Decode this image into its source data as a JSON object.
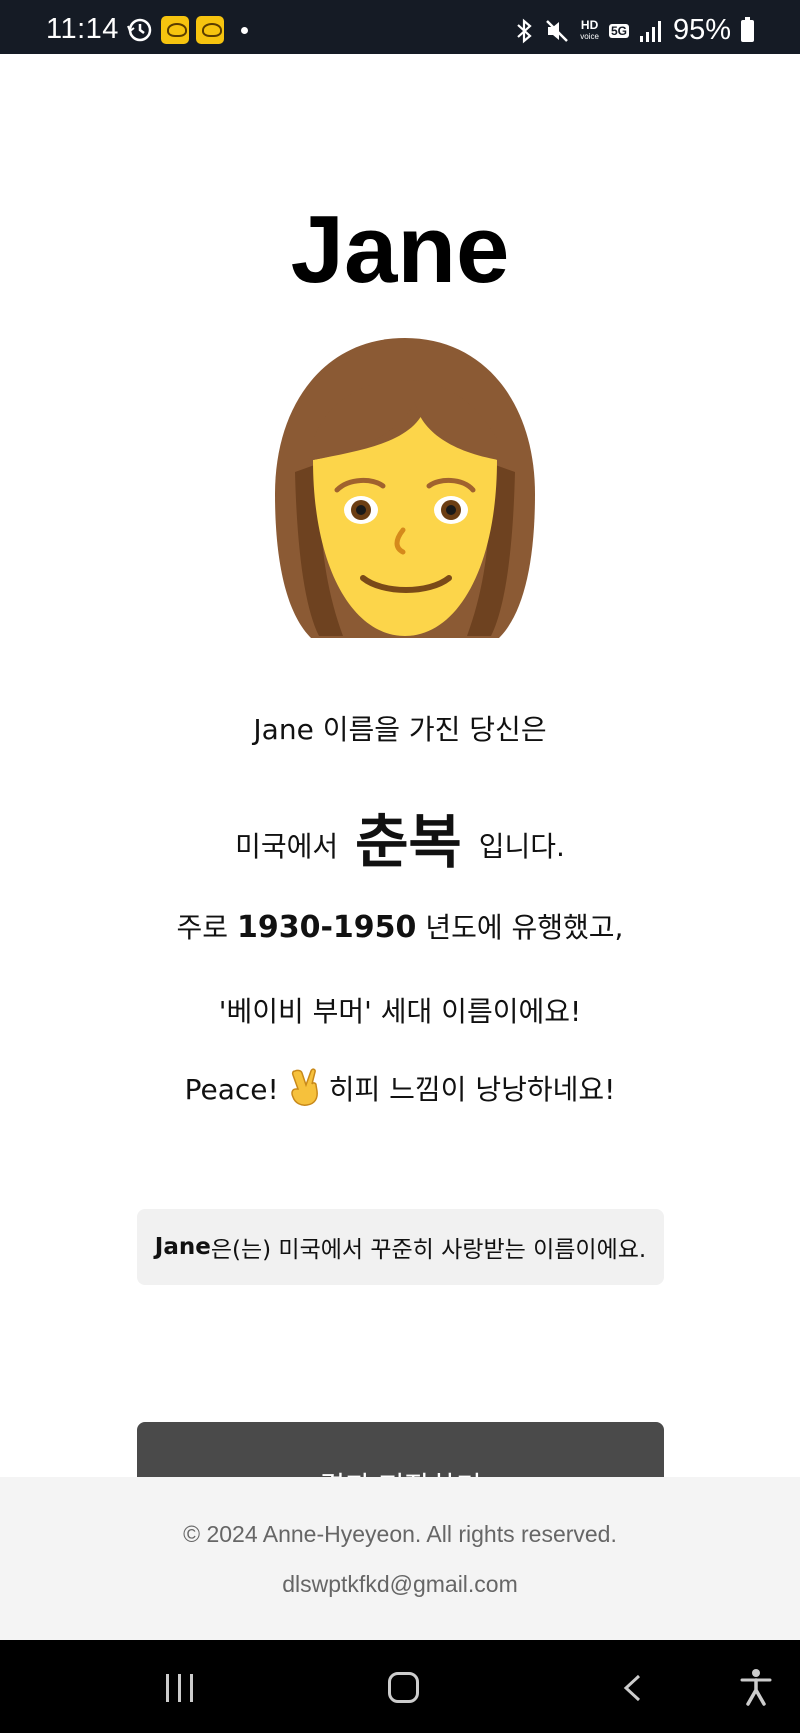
{
  "status_bar": {
    "time": "11:14",
    "hd_label": "HD",
    "voice_label": "voice",
    "network_label": "5G",
    "battery": "95%"
  },
  "main": {
    "name": "Jane",
    "line1": "Jane 이름을 가진 당신은",
    "line2_prefix": "미국에서",
    "era_word": "춘복",
    "line2_suffix": "입니다.",
    "line3_prefix": "주로",
    "years": "1930-1950",
    "line3_suffix": "년도에 유행했고,",
    "line4": "'베이비 부머' 세대 이름이에요!",
    "line5_prefix": "Peace!",
    "line5_suffix": "히피 느낌이 낭낭하네요!",
    "info_name": "Jane",
    "info_text": "은(는) 미국에서 꾸준히 사랑받는 이름이에요.",
    "save_button": "결과 저장하기"
  },
  "footer": {
    "copyright": "© 2024 Anne-Hyeyeon. All rights reserved.",
    "email": "dlswptkfkd@gmail.com"
  },
  "icons": {
    "avatar": "woman-emoji",
    "peace": "victory-hand-emoji"
  },
  "colors": {
    "status_bar": "#151b25",
    "button": "#4a4a4a",
    "info_box": "#f1f1f1",
    "footer": "#f4f4f4"
  }
}
